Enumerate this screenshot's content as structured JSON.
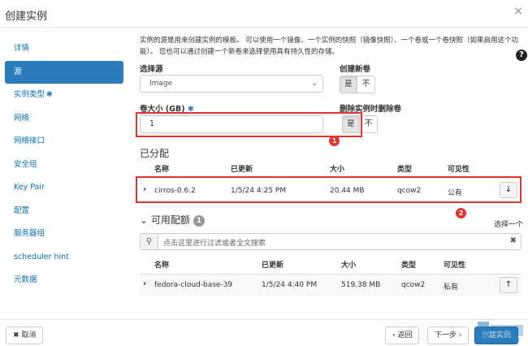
{
  "dialog": {
    "title": "创建实例",
    "close": "×"
  },
  "help": "?",
  "sidebar": {
    "items": [
      {
        "label": "详情"
      },
      {
        "label": "源"
      },
      {
        "label": "实例类型",
        "required": "✱"
      },
      {
        "label": "网络"
      },
      {
        "label": "网络接口"
      },
      {
        "label": "安全组"
      },
      {
        "label": "Key Pair"
      },
      {
        "label": "配置"
      },
      {
        "label": "服务器组"
      },
      {
        "label": "scheduler hint"
      },
      {
        "label": "元数据"
      }
    ]
  },
  "source": {
    "description": "实例的源是用来创建实例的模板。 可以使用一个镜像、一个实例的快照（镜像快照）、一个卷或一个卷快照（如果启用这个功能）。 您也可以通过创建一个新卷来选择使用具有持久性的存储。",
    "select_source_label": "选择源",
    "select_source_value": "Image",
    "create_volume_label": "创建新卷",
    "volume_size_label": "卷大小 (GB)",
    "required_mark": "✱",
    "volume_size_value": "1",
    "delete_volume_label": "删除实例时删除卷",
    "yes": "是",
    "no": "不"
  },
  "allocated": {
    "title": "已分配",
    "headers": [
      "名称",
      "已更新",
      "大小",
      "类型",
      "可见性"
    ],
    "rows": [
      {
        "name": "cirros-0.6.2",
        "updated": "1/5/24 4:25 PM",
        "size": "20.44 MB",
        "type": "qcow2",
        "visibility": "公有"
      }
    ]
  },
  "available": {
    "title": "可用配额",
    "count": "1",
    "select_one": "选择一个",
    "search_placeholder": "点击这里进行过滤或者全文搜索",
    "headers": [
      "名称",
      "已更新",
      "大小",
      "类型",
      "可见性"
    ],
    "rows": [
      {
        "name": "fedora-cloud-base-39",
        "updated": "1/5/24 4:40 PM",
        "size": "519.38 MB",
        "type": "qcow2",
        "visibility": "私有"
      }
    ]
  },
  "annotations": {
    "one": "1",
    "two": "2"
  },
  "footer": {
    "cancel": "✖ 取消",
    "back": "‹ 返回",
    "next": "下一步 ›",
    "create": "创建实例"
  },
  "watermark": "ITDAI.COM"
}
